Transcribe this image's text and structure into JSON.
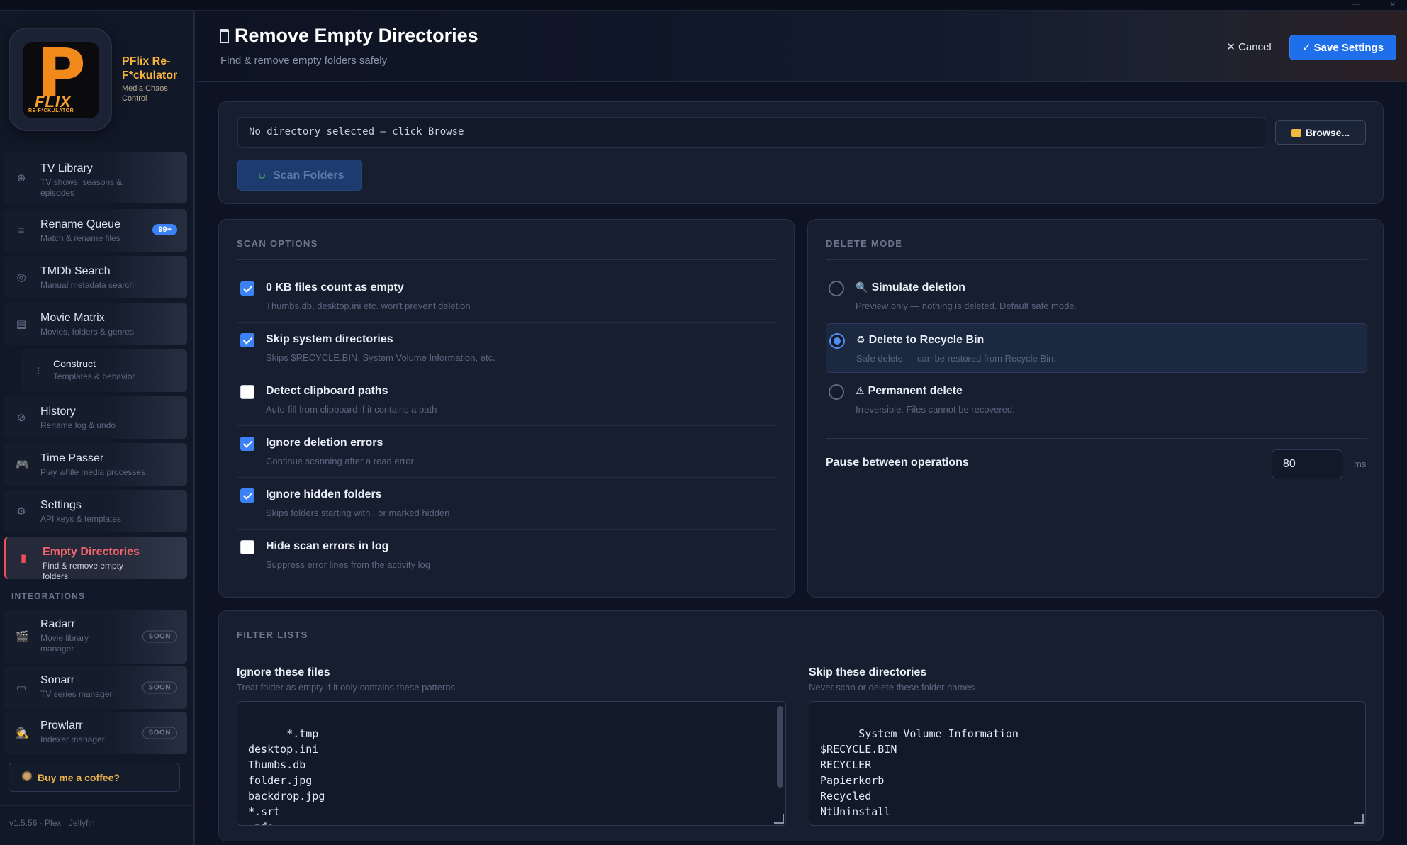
{
  "sidebar": {
    "brand": {
      "name": "PFlix Re-F*ckulator",
      "tagline": "Media Chaos Control",
      "logo_text": "FLIX",
      "logo_subtext": "RE-F*CKULATOR"
    },
    "items": [
      {
        "title": "TV Library",
        "sub": "TV shows, seasons & episodes",
        "icon": "globe-icon"
      },
      {
        "title": "Rename Queue",
        "sub": "Match & rename files",
        "icon": "list-icon",
        "badge": "99+"
      },
      {
        "title": "TMDb Search",
        "sub": "Manual metadata search",
        "icon": "target-icon"
      },
      {
        "title": "Movie Matrix",
        "sub": "Movies, folders & genres",
        "icon": "grid-icon"
      },
      {
        "title": "Construct",
        "sub": "Templates & behavior",
        "icon": "lines-icon"
      },
      {
        "title": "History",
        "sub": "Rename log & undo",
        "icon": "clock-icon"
      },
      {
        "title": "Time Passer",
        "sub": "Play while media processes",
        "icon": "gamepad-icon"
      },
      {
        "title": "Settings",
        "sub": "API keys & templates",
        "icon": "gear-icon"
      },
      {
        "title": "Empty Directories",
        "sub": "Find & remove empty folders",
        "icon": "trash-icon"
      }
    ],
    "integrations_title": "INTEGRATIONS",
    "integrations": [
      {
        "title": "Radarr",
        "sub": "Movie library manager",
        "badge": "SOON",
        "icon": "clapper-icon"
      },
      {
        "title": "Sonarr",
        "sub": "TV series manager",
        "badge": "SOON",
        "icon": "tv-icon"
      },
      {
        "title": "Prowlarr",
        "sub": "Indexer manager",
        "badge": "SOON",
        "icon": "detective-icon"
      }
    ],
    "coffee_label": "Buy me a coffee?",
    "version": "v1.5.56 · Plex · Jellyfin"
  },
  "header": {
    "title": "Remove Empty Directories",
    "subtitle": "Find & remove empty folders safely",
    "cancel_label": "Cancel",
    "save_label": "✓ Save Settings"
  },
  "directory": {
    "value": "No directory selected — click Browse",
    "browse_label": "Browse...",
    "scan_label": "Scan Folders"
  },
  "scan_options": {
    "label": "SCAN OPTIONS",
    "options": [
      {
        "title": "0 KB files count as empty",
        "desc": "Thumbs.db, desktop.ini etc. won't prevent deletion",
        "checked": true
      },
      {
        "title": "Skip system directories",
        "desc": "Skips $RECYCLE.BIN, System Volume Information, etc.",
        "checked": true
      },
      {
        "title": "Detect clipboard paths",
        "desc": "Auto-fill from clipboard if it contains a path",
        "checked": false
      },
      {
        "title": "Ignore deletion errors",
        "desc": "Continue scanning after a read error",
        "checked": true
      },
      {
        "title": "Ignore hidden folders",
        "desc": "Skips folders starting with . or marked hidden",
        "checked": true
      },
      {
        "title": "Hide scan errors in log",
        "desc": "Suppress error lines from the activity log",
        "checked": false
      }
    ]
  },
  "delete_mode": {
    "label": "DELETE MODE",
    "options": [
      {
        "title": "Simulate deletion",
        "desc": "Preview only — nothing is deleted. Default safe mode.",
        "icon": "magnifier-icon",
        "selected": false
      },
      {
        "title": "Delete to Recycle Bin",
        "desc": "Safe delete — can be restored from Recycle Bin.",
        "icon": "recycle-icon",
        "selected": true
      },
      {
        "title": "Permanent delete",
        "desc": "Irreversible. Files cannot be recovered.",
        "icon": "warning-icon",
        "selected": false
      }
    ],
    "pause_label": "Pause between operations",
    "pause_value": "80",
    "pause_unit": "ms"
  },
  "filter_lists": {
    "label": "FILTER LISTS",
    "ignore_files": {
      "title": "Ignore these files",
      "desc": "Treat folder as empty if it only contains these patterns",
      "value": "*.tmp\ndesktop.ini\nThumbs.db\nfolder.jpg\nbackdrop.jpg\n*.srt\n.nfo\nmovie.xml"
    },
    "skip_dirs": {
      "title": "Skip these directories",
      "desc": "Never scan or delete these folder names",
      "value": "System Volume Information\n$RECYCLE.BIN\nRECYCLER\nPapierkorb\nRecycled\nNtUninstall"
    }
  },
  "colors": {
    "accent": "#1f6fea",
    "active_nav": "#ef4d5a",
    "brand": "#f18a1a",
    "panel": "#161e2f"
  }
}
